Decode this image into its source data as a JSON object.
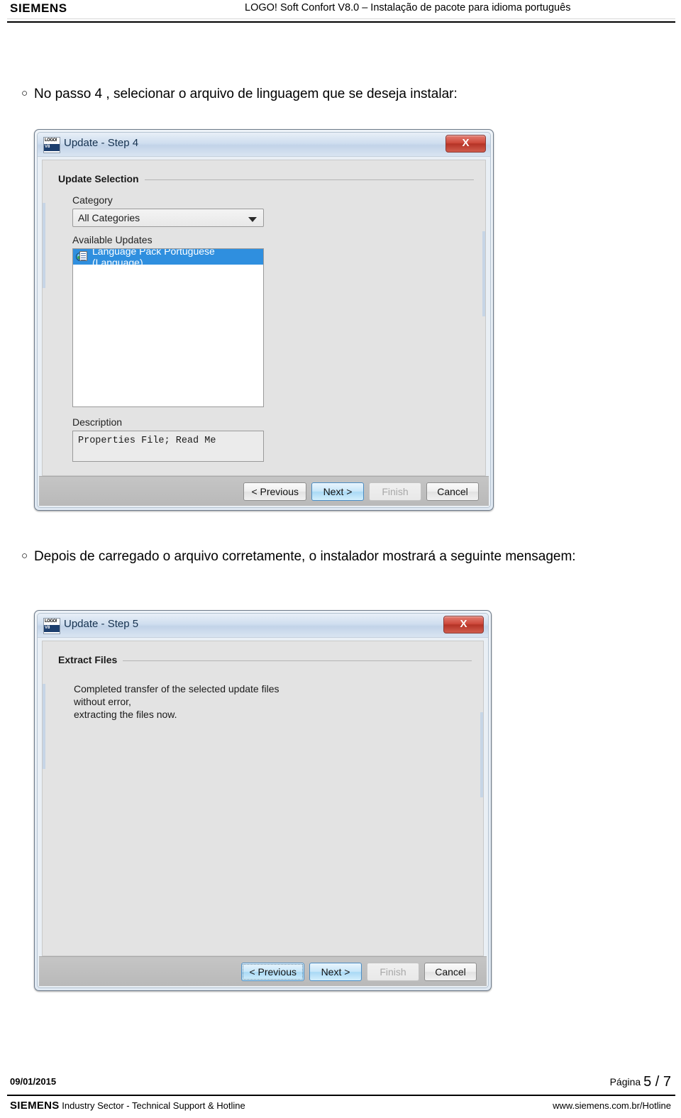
{
  "header": {
    "brand": "SIEMENS",
    "title": "LOGO! Soft Confort V8.0 – Instalação de pacote para idioma português"
  },
  "paragraphs": {
    "bullet_mark": "○",
    "p1": "No passo 4 , selecionar o arquivo de linguagem que se deseja instalar:",
    "p2": "Depois de carregado o arquivo corretamente, o instalador mostrará a seguinte mensagem:"
  },
  "dialog1": {
    "icon_top": "LOGO!",
    "icon_bottom": "V8",
    "title": "Update - Step 4",
    "close_label": "X",
    "group_title": "Update Selection",
    "category_label": "Category",
    "category_value": "All Categories",
    "available_label": "Available Updates",
    "list_items": [
      {
        "label": "Language Pack Portuguese (Language)",
        "selected": true
      }
    ],
    "description_label": "Description",
    "description_value": "Properties File; Read Me",
    "buttons": [
      {
        "label": "< Previous",
        "state": "normal"
      },
      {
        "label": "Next >",
        "state": "primary"
      },
      {
        "label": "Finish",
        "state": "disabled"
      },
      {
        "label": "Cancel",
        "state": "normal"
      }
    ]
  },
  "dialog2": {
    "icon_top": "LOGO!",
    "icon_bottom": "V8",
    "title": "Update - Step 5",
    "close_label": "X",
    "group_title": "Extract Files",
    "message": "Completed transfer of the selected update files\nwithout error,\nextracting the files now.",
    "buttons": [
      {
        "label": "< Previous",
        "state": "focused"
      },
      {
        "label": "Next >",
        "state": "primary"
      },
      {
        "label": "Finish",
        "state": "disabled"
      },
      {
        "label": "Cancel",
        "state": "normal"
      }
    ]
  },
  "footer": {
    "date": "09/01/2015",
    "page_prefix": "Página",
    "page_value": "5 / 7",
    "brand": "SIEMENS",
    "department": "Industry Sector  - Technical Support & Hotline",
    "url": "www.siemens.com.br/Hotline"
  },
  "colors": {
    "selection_blue": "#2f8fdf",
    "close_red": "#b53326",
    "title_text": "#15314f",
    "dialog_bg": "#e3e3e3"
  }
}
